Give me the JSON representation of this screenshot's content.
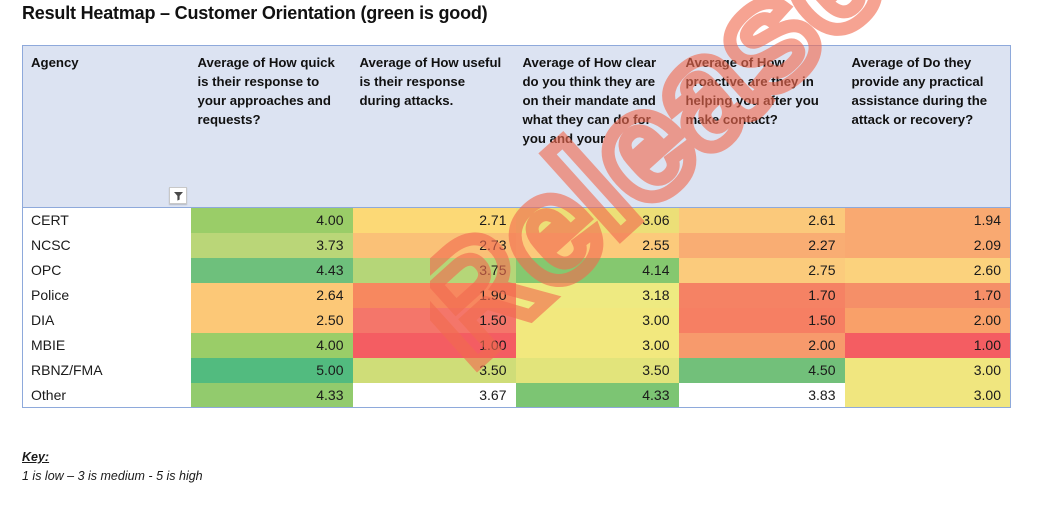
{
  "page_title": "Result Heatmap – Customer Orientation (green is good)",
  "watermark": {
    "text": "Released",
    "color": "#f26b50"
  },
  "toolbar": {
    "filter_icon": "filter-funnel-icon"
  },
  "key": {
    "label": "Key:",
    "text": "1 is low – 3 is medium - 5 is high"
  },
  "table": {
    "headers": [
      "Agency",
      "Average of How quick is their response to your approaches and requests?",
      "Average of How useful is their response during attacks.",
      "Average of How clear do you think they are on their mandate and what they can do for you and your",
      "Average of How proactive are they in helping you after you make contact?",
      "Average of Do they provide any practical assistance during the attack or recovery?"
    ],
    "rows": [
      {
        "agency": "CERT",
        "values": [
          "4.00",
          "2.71",
          "3.06",
          "2.61",
          "1.94"
        ],
        "colors": [
          "#9acd68",
          "#fcd976",
          "#ecdf77",
          "#fbc97b",
          "#f9a971"
        ]
      },
      {
        "agency": "NCSC",
        "values": [
          "3.73",
          "2.73",
          "2.55",
          "2.27",
          "2.09"
        ],
        "colors": [
          "#bad678",
          "#fac177",
          "#fcca7b",
          "#f9ad73",
          "#f9a971"
        ]
      },
      {
        "agency": "OPC",
        "values": [
          "4.43",
          "3.75",
          "4.14",
          "2.75",
          "2.60"
        ],
        "colors": [
          "#6ec07c",
          "#b5d678",
          "#85c86f",
          "#fbcb7c",
          "#fbd27d"
        ]
      },
      {
        "agency": "Police",
        "values": [
          "2.64",
          "1.90",
          "3.18",
          "1.70",
          "1.70"
        ],
        "colors": [
          "#fcc877",
          "#f7885f",
          "#eeea81",
          "#f58264",
          "#f58f68"
        ]
      },
      {
        "agency": "DIA",
        "values": [
          "2.50",
          "1.50",
          "3.00",
          "1.50",
          "2.00"
        ],
        "colors": [
          "#fcc877",
          "#f4766a",
          "#f2e87e",
          "#f67f63",
          "#f9a069"
        ]
      },
      {
        "agency": "MBIE",
        "values": [
          "4.00",
          "1.00",
          "3.00",
          "2.00",
          "1.00"
        ],
        "colors": [
          "#9acd68",
          "#f45d62",
          "#f2e87e",
          "#f79a6c",
          "#f45d62"
        ]
      },
      {
        "agency": "RBNZ/FMA",
        "values": [
          "5.00",
          "3.50",
          "3.50",
          "4.50",
          "3.00"
        ],
        "colors": [
          "#52bb7f",
          "#cfdd78",
          "#e2e47b",
          "#72c07a",
          "#f0e67f"
        ]
      },
      {
        "agency": "Other",
        "values": [
          "4.33",
          "3.67",
          "4.33",
          "3.83",
          "3.00"
        ],
        "colors": [
          "#92cb6d",
          "#ffffff",
          "#7cc573",
          "#ffffff",
          "#f0e67f"
        ]
      }
    ]
  }
}
